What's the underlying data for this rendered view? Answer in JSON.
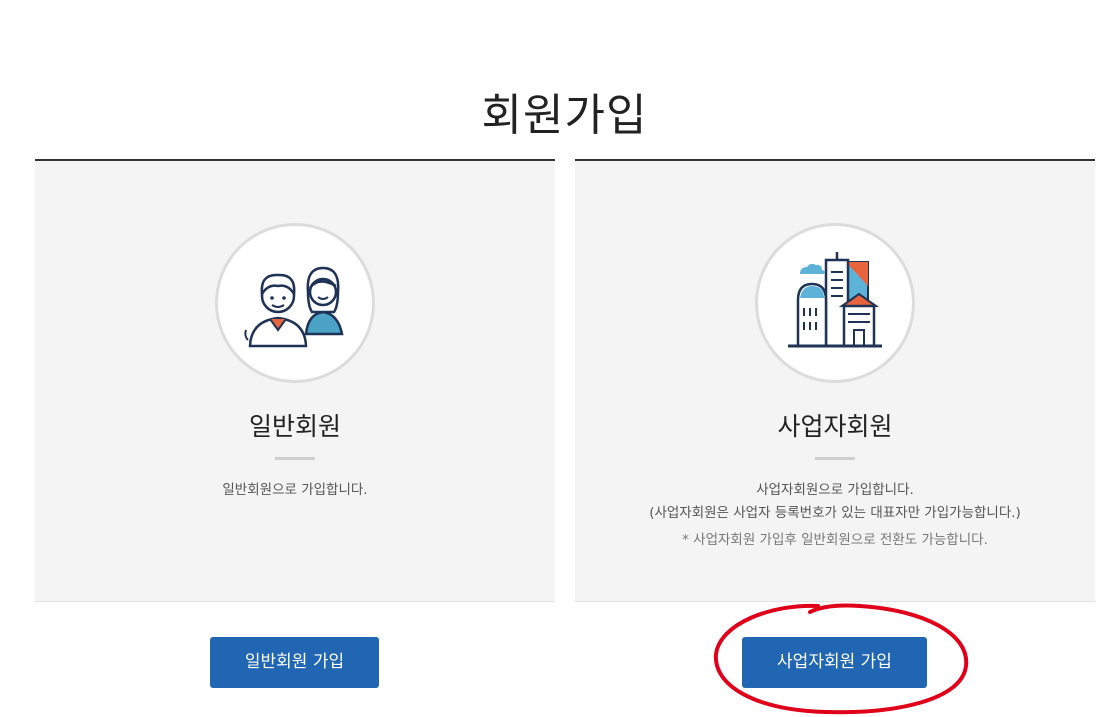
{
  "page": {
    "title": "회원가입"
  },
  "cards": {
    "general": {
      "icon": "people-icon",
      "title": "일반회원",
      "description": "일반회원으로 가입합니다.",
      "button_label": "일반회원 가입"
    },
    "business": {
      "icon": "buildings-icon",
      "title": "사업자회원",
      "description_line1": "사업자회원으로 가입합니다.",
      "description_line2": "(사업자회원은 사업자 등록번호가 있는 대표자만 가입가능합니다.)",
      "note": "* 사업자회원 가입후 일반회원으로 전환도 가능합니다.",
      "button_label": "사업자회원 가입"
    }
  },
  "annotation": {
    "type": "red-ellipse-highlight",
    "target": "business-signup-button"
  },
  "colors": {
    "primary_button": "#2166b2",
    "card_background": "#f4f4f4",
    "annotation_red": "#e0001a"
  }
}
